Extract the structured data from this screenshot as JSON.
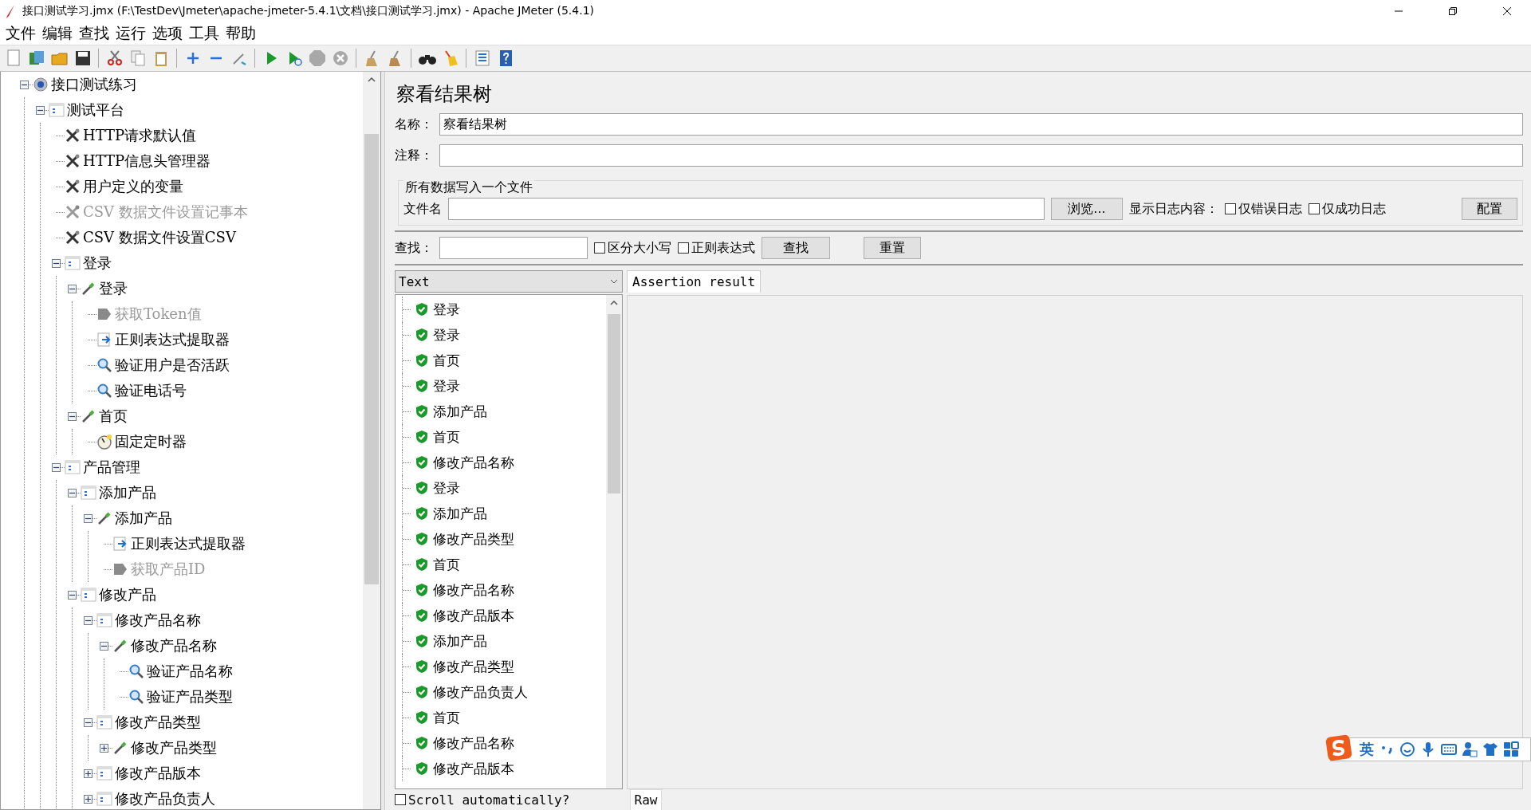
{
  "window": {
    "title": "接口测试学习.jmx (F:\\TestDev\\Jmeter\\apache-jmeter-5.4.1\\文档\\接口测试学习.jmx) - Apache JMeter (5.4.1)"
  },
  "menu": [
    "文件",
    "编辑",
    "查找",
    "运行",
    "选项",
    "工具",
    "帮助"
  ],
  "tree": [
    {
      "label": "接口测试练习",
      "kind": "plan",
      "disabled": false,
      "expanded": true,
      "children": [
        {
          "label": "测试平台",
          "kind": "group",
          "disabled": false,
          "expanded": true,
          "children": [
            {
              "label": "HTTP请求默认值",
              "kind": "config",
              "disabled": false
            },
            {
              "label": "HTTP信息头管理器",
              "kind": "config",
              "disabled": false
            },
            {
              "label": "用户定义的变量",
              "kind": "config",
              "disabled": false
            },
            {
              "label": "CSV 数据文件设置记事本",
              "kind": "config",
              "disabled": true
            },
            {
              "label": "CSV 数据文件设置CSV",
              "kind": "config",
              "disabled": false
            },
            {
              "label": "登录",
              "kind": "group",
              "disabled": false,
              "expanded": true,
              "children": [
                {
                  "label": "登录",
                  "kind": "sampler",
                  "disabled": false,
                  "expanded": true,
                  "children": [
                    {
                      "label": "获取Token值",
                      "kind": "postprocessor",
                      "disabled": true
                    },
                    {
                      "label": "正则表达式提取器",
                      "kind": "extractor",
                      "disabled": false
                    },
                    {
                      "label": "验证用户是否活跃",
                      "kind": "assertion",
                      "disabled": false
                    },
                    {
                      "label": "验证电话号",
                      "kind": "assertion",
                      "disabled": false
                    }
                  ]
                },
                {
                  "label": "首页",
                  "kind": "sampler",
                  "disabled": false,
                  "expanded": true,
                  "children": [
                    {
                      "label": "固定定时器",
                      "kind": "timer",
                      "disabled": false
                    }
                  ]
                }
              ]
            },
            {
              "label": "产品管理",
              "kind": "group",
              "disabled": false,
              "expanded": true,
              "children": [
                {
                  "label": "添加产品",
                  "kind": "group",
                  "disabled": false,
                  "expanded": true,
                  "children": [
                    {
                      "label": "添加产品",
                      "kind": "sampler",
                      "disabled": false,
                      "expanded": true,
                      "children": [
                        {
                          "label": "正则表达式提取器",
                          "kind": "extractor",
                          "disabled": false
                        },
                        {
                          "label": "获取产品ID",
                          "kind": "postprocessor",
                          "disabled": true
                        }
                      ]
                    }
                  ]
                },
                {
                  "label": "修改产品",
                  "kind": "group",
                  "disabled": false,
                  "expanded": true,
                  "children": [
                    {
                      "label": "修改产品名称",
                      "kind": "group",
                      "disabled": false,
                      "expanded": true,
                      "children": [
                        {
                          "label": "修改产品名称",
                          "kind": "sampler",
                          "disabled": false,
                          "expanded": true,
                          "children": [
                            {
                              "label": "验证产品名称",
                              "kind": "assertion",
                              "disabled": false
                            },
                            {
                              "label": "验证产品类型",
                              "kind": "assertion",
                              "disabled": false
                            }
                          ]
                        }
                      ]
                    },
                    {
                      "label": "修改产品类型",
                      "kind": "group",
                      "disabled": false,
                      "expanded": true,
                      "children": [
                        {
                          "label": "修改产品类型",
                          "kind": "sampler",
                          "disabled": false,
                          "expanded": false
                        }
                      ]
                    },
                    {
                      "label": "修改产品版本",
                      "kind": "group",
                      "disabled": false,
                      "expanded": false
                    },
                    {
                      "label": "修改产品负责人",
                      "kind": "group",
                      "disabled": false,
                      "expanded": false
                    }
                  ]
                }
              ]
            }
          ]
        }
      ]
    }
  ],
  "panel": {
    "title": "察看结果树",
    "name_label": "名称：",
    "name_value": "察看结果树",
    "comment_label": "注释：",
    "file_group": {
      "legend": "所有数据写入一个文件",
      "file_label": "文件名",
      "browse_button": "浏览...",
      "log_label": "显示日志内容：",
      "options": [
        {
          "label": "仅错误日志",
          "checked": false
        },
        {
          "label": "仅成功日志",
          "checked": false
        }
      ],
      "config_button": "配置"
    },
    "search": {
      "label": "查找：",
      "options": [
        {
          "label": "区分大小写",
          "checked": false
        },
        {
          "label": "正则表达式",
          "checked": false
        }
      ],
      "find_button": "查找",
      "reset_button": "重置"
    },
    "renderer": "Text",
    "results": [
      {
        "label": "登录",
        "passed": true
      },
      {
        "label": "登录",
        "passed": true
      },
      {
        "label": "首页",
        "passed": true
      },
      {
        "label": "登录",
        "passed": true
      },
      {
        "label": "添加产品",
        "passed": true
      },
      {
        "label": "首页",
        "passed": true
      },
      {
        "label": "修改产品名称",
        "passed": true
      },
      {
        "label": "登录",
        "passed": true
      },
      {
        "label": "添加产品",
        "passed": true
      },
      {
        "label": "修改产品类型",
        "passed": true
      },
      {
        "label": "首页",
        "passed": true
      },
      {
        "label": "修改产品名称",
        "passed": true
      },
      {
        "label": "修改产品版本",
        "passed": true
      },
      {
        "label": "添加产品",
        "passed": true
      },
      {
        "label": "修改产品类型",
        "passed": true
      },
      {
        "label": "修改产品负责人",
        "passed": true
      },
      {
        "label": "首页",
        "passed": true
      },
      {
        "label": "修改产品名称",
        "passed": true
      },
      {
        "label": "修改产品版本",
        "passed": true
      }
    ],
    "scroll_automatically": {
      "label": "Scroll automatically?",
      "checked": false
    },
    "tabs": [
      {
        "label": "Assertion result",
        "selected": true
      }
    ],
    "bottom_tab": "Raw"
  },
  "ime": {
    "mode": "英"
  }
}
